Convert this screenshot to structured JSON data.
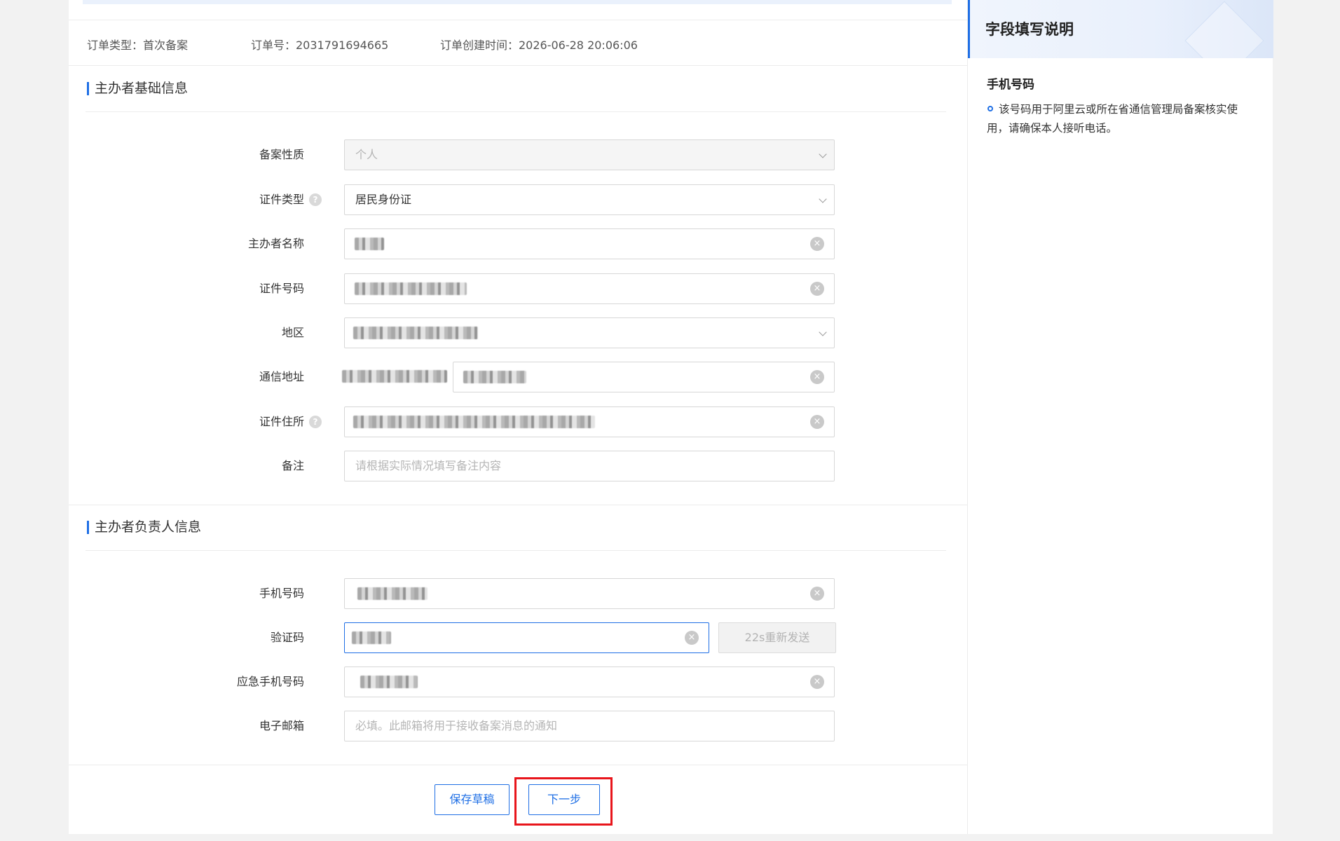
{
  "order": {
    "type": "订单类型：首次备案",
    "number": "订单号：2031791694665",
    "created": "订单创建时间：2026-06-28 20:06:06"
  },
  "section_basic": {
    "title": "主办者基础信息",
    "fields": {
      "nature": {
        "label": "备案性质",
        "value": "个人"
      },
      "id_type": {
        "label": "证件类型",
        "value": "居民身份证"
      },
      "name": {
        "label": "主办者名称"
      },
      "id_number": {
        "label": "证件号码"
      },
      "region": {
        "label": "地区"
      },
      "address": {
        "label": "通信地址"
      },
      "id_address": {
        "label": "证件住所"
      },
      "remark": {
        "label": "备注",
        "placeholder": "请根据实际情况填写备注内容"
      }
    }
  },
  "section_contact": {
    "title": "主办者负责人信息",
    "fields": {
      "phone": {
        "label": "手机号码"
      },
      "code": {
        "label": "验证码",
        "resend": "22s重新发送"
      },
      "emergency_phone": {
        "label": "应急手机号码"
      },
      "email": {
        "label": "电子邮箱",
        "placeholder": "必填。此邮箱将用于接收备案消息的通知"
      }
    }
  },
  "actions": {
    "save_draft": "保存草稿",
    "next": "下一步"
  },
  "sidebar": {
    "title": "字段填写说明",
    "field_name": "手机号码",
    "description": "该号码用于阿里云或所在省通信管理局备案核实使用，请确保本人接听电话。"
  },
  "colors": {
    "accent": "#1f6fe5",
    "highlight": "#e8151b"
  }
}
